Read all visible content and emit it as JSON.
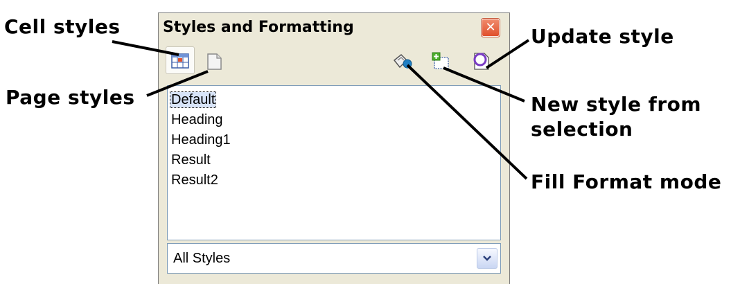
{
  "callouts": {
    "cell_styles": "Cell styles",
    "page_styles": "Page styles",
    "update_style": "Update style",
    "new_style_line1": "New style from",
    "new_style_line2": "selection",
    "fill_format": "Fill Format mode"
  },
  "panel": {
    "title": "Styles and Formatting",
    "close_symbol": "✕"
  },
  "toolbar": {
    "icons": [
      "cell-styles-icon",
      "page-styles-icon",
      "fill-format-icon",
      "new-style-icon",
      "update-style-icon"
    ]
  },
  "style_list": {
    "items": [
      "Default",
      "Heading",
      "Heading1",
      "Result",
      "Result2"
    ],
    "selected": "Default"
  },
  "filter": {
    "value": "All Styles"
  },
  "colors": {
    "panel_bg": "#ece9d8",
    "close_red": "#e0502c",
    "list_border": "#7f9db9"
  }
}
